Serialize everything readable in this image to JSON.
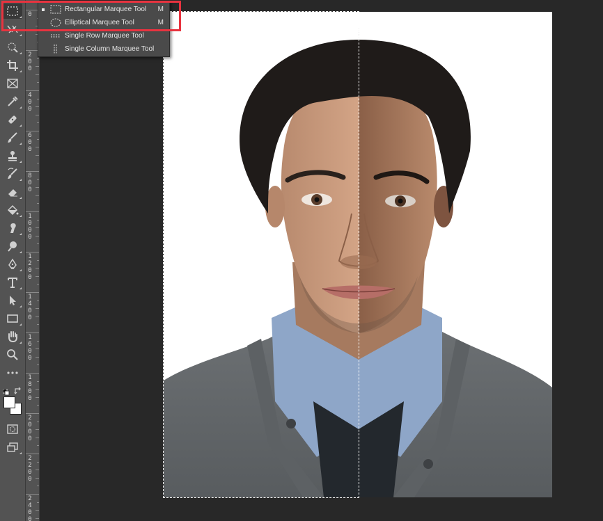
{
  "toolbar": {
    "tools": [
      {
        "name": "rectangular-marquee-icon",
        "active": true
      },
      {
        "name": "move-icon"
      },
      {
        "name": "quick-selection-icon"
      },
      {
        "name": "crop-icon"
      },
      {
        "name": "frame-icon"
      },
      {
        "name": "eyedropper-icon"
      },
      {
        "name": "healing-brush-icon"
      },
      {
        "name": "brush-icon"
      },
      {
        "name": "clone-stamp-icon"
      },
      {
        "name": "history-brush-icon"
      },
      {
        "name": "eraser-icon"
      },
      {
        "name": "paint-bucket-icon"
      },
      {
        "name": "smudge-icon"
      },
      {
        "name": "dodge-icon"
      },
      {
        "name": "pen-icon"
      },
      {
        "name": "type-icon"
      },
      {
        "name": "path-selection-icon"
      },
      {
        "name": "rectangle-shape-icon"
      },
      {
        "name": "hand-icon"
      },
      {
        "name": "zoom-icon"
      },
      {
        "name": "more-tools-icon"
      }
    ],
    "foreground_color": "#ffffff",
    "background_color": "#ffffff"
  },
  "ruler": {
    "labels": [
      "0",
      "2\n0\n0",
      "4\n0\n0",
      "6\n0\n0",
      "8\n0\n0",
      "1\n0\n0\n0",
      "1\n2\n0\n0",
      "1\n4\n0\n0",
      "1\n6\n0\n0",
      "1\n8\n0\n0",
      "2\n0\n0\n0",
      "2\n2\n0\n0",
      "2\n4\n0\n0"
    ]
  },
  "flyout": {
    "items": [
      {
        "label": "Rectangular Marquee Tool",
        "shortcut": "M",
        "selected": true,
        "icon": "rectangle-dashed-icon"
      },
      {
        "label": "Elliptical Marquee Tool",
        "shortcut": "M",
        "selected": false,
        "icon": "ellipse-dashed-icon"
      },
      {
        "label": "Single Row Marquee Tool",
        "shortcut": "",
        "selected": false,
        "icon": "single-row-icon"
      },
      {
        "label": "Single Column Marquee Tool",
        "shortcut": "",
        "selected": false,
        "icon": "single-column-icon"
      }
    ]
  },
  "highlight_color": "#e8333f"
}
